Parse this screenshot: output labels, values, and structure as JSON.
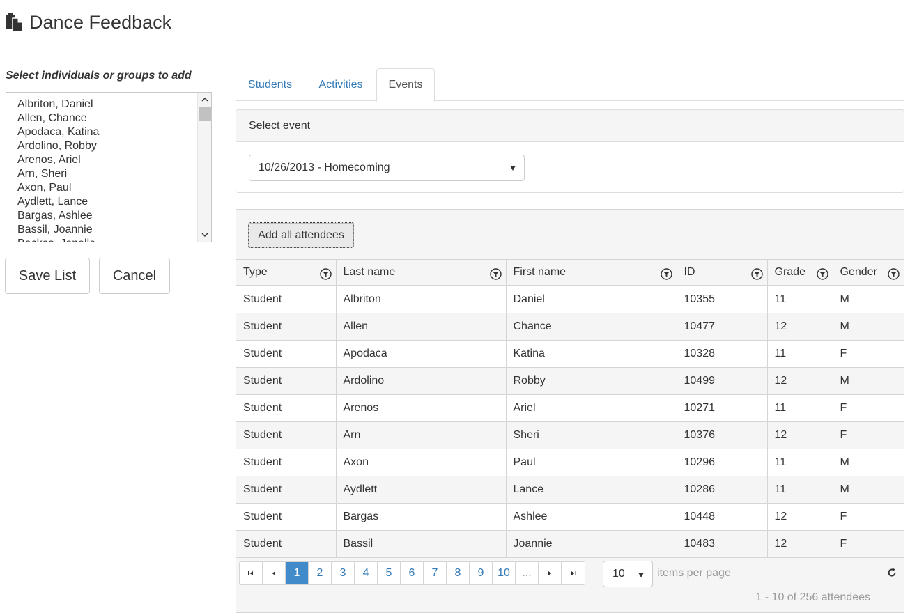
{
  "app": {
    "title": "Dance Feedback"
  },
  "left": {
    "label": "Select individuals or groups to add",
    "list": [
      "Albriton, Daniel",
      "Allen, Chance",
      "Apodaca, Katina",
      "Ardolino, Robby",
      "Arenos, Ariel",
      "Arn, Sheri",
      "Axon, Paul",
      "Aydlett, Lance",
      "Bargas, Ashlee",
      "Bassil, Joannie",
      "Backes, Janelle"
    ],
    "save_label": "Save List",
    "cancel_label": "Cancel"
  },
  "tabs": [
    {
      "label": "Students",
      "active": false
    },
    {
      "label": "Activities",
      "active": false
    },
    {
      "label": "Events",
      "active": true
    }
  ],
  "event_panel": {
    "heading": "Select event",
    "selected": "10/26/2013 - Homecoming"
  },
  "grid": {
    "add_all_label": "Add all attendees",
    "columns": [
      "Type",
      "Last name",
      "First name",
      "ID",
      "Grade",
      "Gender"
    ],
    "rows": [
      [
        "Student",
        "Albriton",
        "Daniel",
        "10355",
        "11",
        "M"
      ],
      [
        "Student",
        "Allen",
        "Chance",
        "10477",
        "12",
        "M"
      ],
      [
        "Student",
        "Apodaca",
        "Katina",
        "10328",
        "11",
        "F"
      ],
      [
        "Student",
        "Ardolino",
        "Robby",
        "10499",
        "12",
        "M"
      ],
      [
        "Student",
        "Arenos",
        "Ariel",
        "10271",
        "11",
        "F"
      ],
      [
        "Student",
        "Arn",
        "Sheri",
        "10376",
        "12",
        "F"
      ],
      [
        "Student",
        "Axon",
        "Paul",
        "10296",
        "11",
        "M"
      ],
      [
        "Student",
        "Aydlett",
        "Lance",
        "10286",
        "11",
        "M"
      ],
      [
        "Student",
        "Bargas",
        "Ashlee",
        "10448",
        "12",
        "F"
      ],
      [
        "Student",
        "Bassil",
        "Joannie",
        "10483",
        "12",
        "F"
      ]
    ],
    "pager": {
      "pages": [
        "1",
        "2",
        "3",
        "4",
        "5",
        "6",
        "7",
        "8",
        "9",
        "10"
      ],
      "ellipsis": "...",
      "current": "1",
      "page_size": "10",
      "items_per_page_label": "items per page",
      "info": "1 - 10 of 256 attendees"
    }
  },
  "colors": {
    "link": "#337ab7",
    "pager_active": "#428bca",
    "border": "#d5d5d5",
    "alt_row": "#f5f5f5"
  }
}
